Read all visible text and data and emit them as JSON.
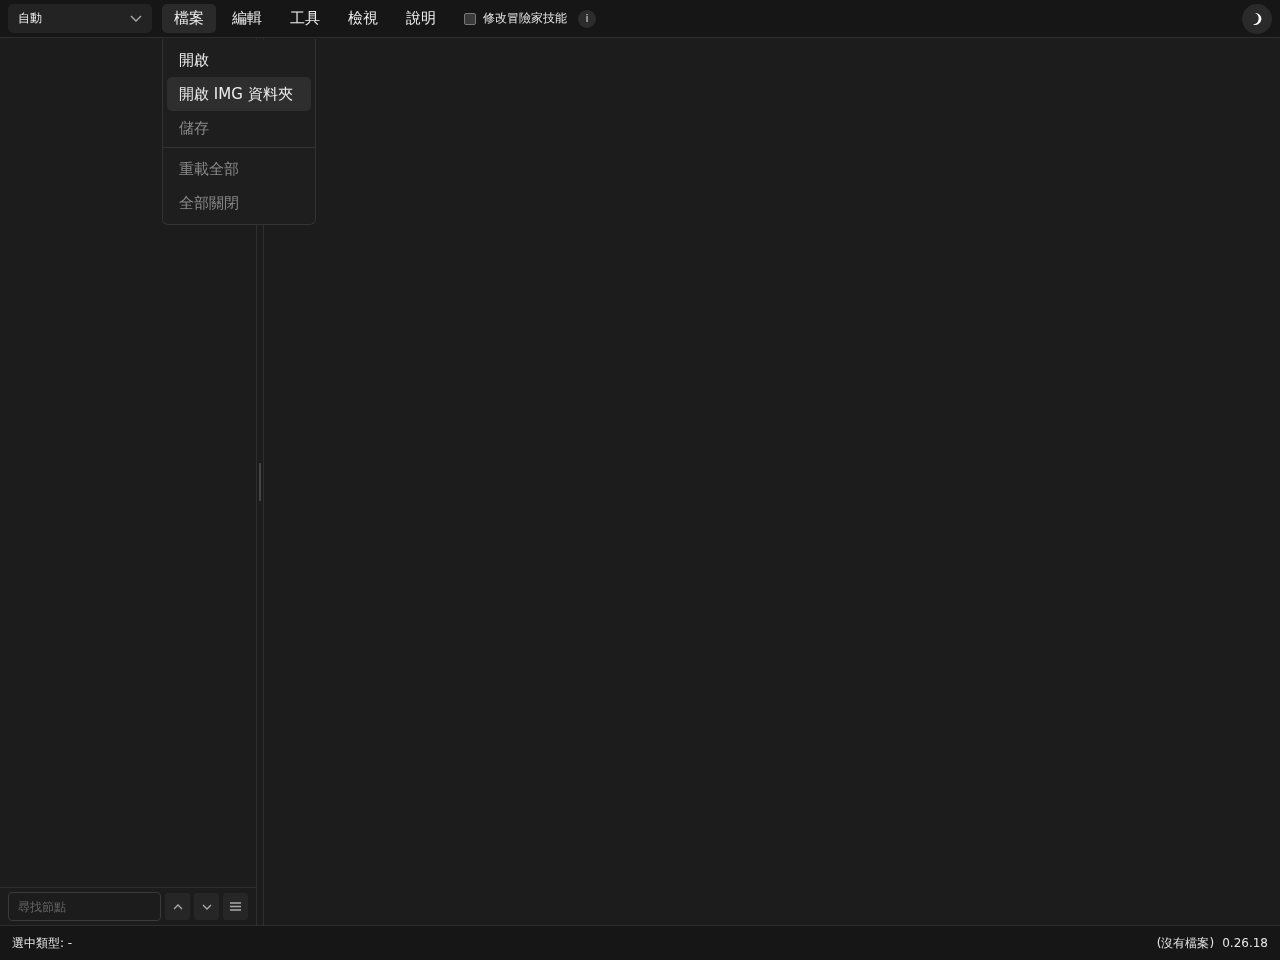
{
  "toolbar": {
    "dropdown": {
      "value": "自動"
    },
    "menus": [
      {
        "label": "檔案",
        "selected": true
      },
      {
        "label": "編輯",
        "selected": false
      },
      {
        "label": "工具",
        "selected": false
      },
      {
        "label": "檢視",
        "selected": false
      },
      {
        "label": "說明",
        "selected": false
      }
    ],
    "checkbox": {
      "label": "修改冒險家技能",
      "checked": false
    },
    "info": "i"
  },
  "open_menu": {
    "groups": [
      [
        {
          "label": "開啟",
          "disabled": false,
          "highlighted": false
        },
        {
          "label": "開啟 IMG 資料夾",
          "disabled": false,
          "highlighted": true
        },
        {
          "label": "儲存",
          "disabled": true,
          "highlighted": false
        }
      ],
      [
        {
          "label": "重載全部",
          "disabled": true,
          "highlighted": false
        },
        {
          "label": "全部關閉",
          "disabled": true,
          "highlighted": false
        }
      ]
    ]
  },
  "sidebar": {
    "search": {
      "placeholder": "尋找節點"
    }
  },
  "status_bar": {
    "left": "選中類型: -",
    "file": "(沒有檔案)",
    "version": "0.26.18"
  }
}
